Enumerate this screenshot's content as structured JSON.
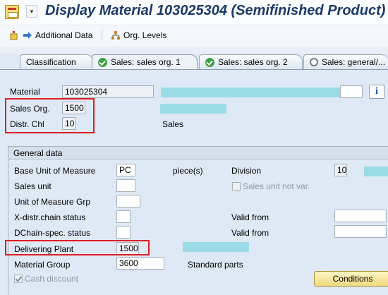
{
  "title": "Display Material 103025304 (Semifinished Product)",
  "title_caret": "▾",
  "toolbar": {
    "additional_data": "Additional Data",
    "org_levels": "Org. Levels"
  },
  "tabs": [
    {
      "label": "Classification"
    },
    {
      "label": "Sales: sales org. 1"
    },
    {
      "label": "Sales: sales org. 2"
    },
    {
      "label": "Sales: general/..."
    }
  ],
  "header": {
    "material_label": "Material",
    "material_value": "103025304",
    "sales_org_label": "Sales Org.",
    "sales_org_value": "1500",
    "distr_chl_label": "Distr. Chl",
    "distr_chl_value": "10",
    "distr_chl_desc": "Sales"
  },
  "general": {
    "title": "General data",
    "base_uom_label": "Base Unit of Measure",
    "base_uom_value": "PC",
    "base_uom_desc": "piece(s)",
    "division_label": "Division",
    "division_value": "10",
    "sales_unit_label": "Sales unit",
    "sales_unit_value": "",
    "sales_unit_not_var": "Sales unit not var.",
    "uom_grp_label": "Unit of Measure Grp",
    "uom_grp_value": "",
    "x_distr_label": "X-distr.chain status",
    "x_distr_value": "",
    "valid_from_label_1": "Valid from",
    "valid_from_value_1": "",
    "dchain_label": "DChain-spec. status",
    "dchain_value": "",
    "valid_from_label_2": "Valid from",
    "valid_from_value_2": "",
    "delivering_plant_label": "Delivering Plant",
    "delivering_plant_value": "1500",
    "material_group_label": "Material Group",
    "material_group_value": "3600",
    "material_group_desc": "Standard parts",
    "cash_discount": "Cash discount",
    "conditions_button": "Conditions"
  },
  "colors": {
    "title": "#1b3a66",
    "highlight_red": "#e01b24",
    "cyan_block": "#9adbe7",
    "background": "#dfe9f5"
  }
}
